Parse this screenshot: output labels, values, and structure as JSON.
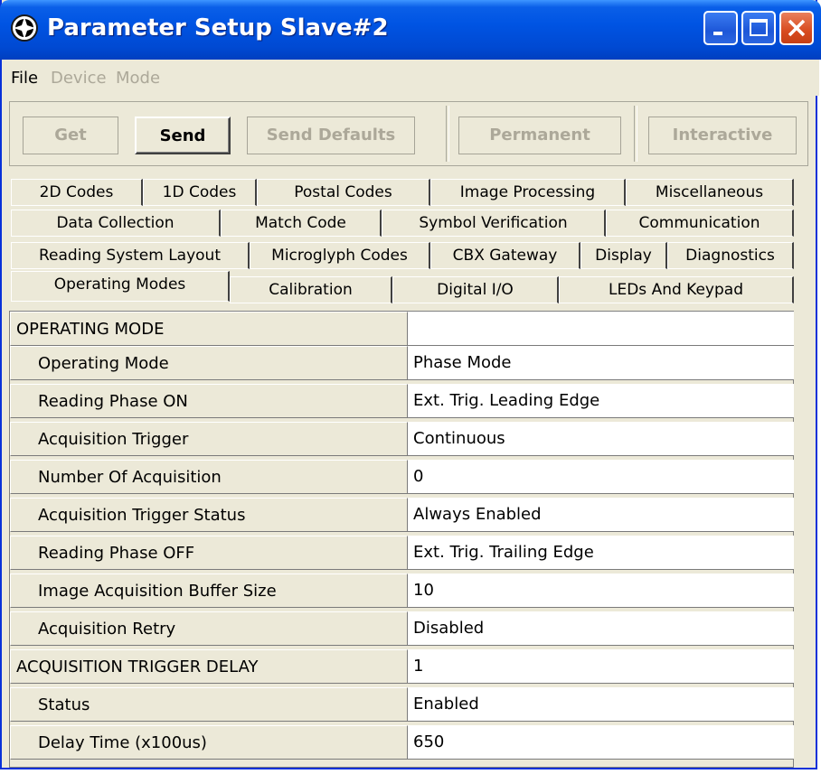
{
  "window": {
    "title": "Parameter Setup Slave#2",
    "colors": {
      "titlebar": "#0054e3",
      "close_button": "#d84b1f",
      "face": "#ece9d8"
    }
  },
  "menu": {
    "items": [
      {
        "label": "File",
        "enabled": true
      },
      {
        "label": "Device",
        "enabled": false
      },
      {
        "label": "Mode",
        "enabled": false
      }
    ]
  },
  "toolbar": {
    "get": "Get",
    "send": "Send",
    "send_defaults": "Send Defaults",
    "permanent": "Permanent",
    "interactive": "Interactive"
  },
  "tabs": {
    "row1": [
      "2D Codes",
      "1D Codes",
      "Postal Codes",
      "Image Processing",
      "Miscellaneous"
    ],
    "row2": [
      "Data Collection",
      "Match Code",
      "Symbol Verification",
      "Communication"
    ],
    "row3": [
      "Reading System Layout",
      "Microglyph Codes",
      "CBX Gateway",
      "Display",
      "Diagnostics"
    ],
    "row4": [
      "Operating Modes",
      "Calibration",
      "Digital I/O",
      "LEDs And Keypad"
    ],
    "active": "Operating Modes"
  },
  "grid": {
    "rows": [
      {
        "label": "OPERATING MODE",
        "value": ""
      },
      {
        "label": "Operating Mode",
        "value": "Phase Mode"
      },
      {
        "label": "Reading Phase ON",
        "value": "Ext. Trig. Leading Edge"
      },
      {
        "label": "Acquisition Trigger",
        "value": "Continuous"
      },
      {
        "label": "Number Of Acquisition",
        "value": "0"
      },
      {
        "label": "Acquisition Trigger Status",
        "value": "Always Enabled"
      },
      {
        "label": "Reading Phase OFF",
        "value": "Ext. Trig. Trailing Edge"
      },
      {
        "label": "Image Acquisition Buffer Size",
        "value": "10"
      },
      {
        "label": "Acquisition Retry",
        "value": "Disabled"
      },
      {
        "label": "ACQUISITION TRIGGER DELAY",
        "value": "1"
      },
      {
        "label": "Status",
        "value": "Enabled"
      },
      {
        "label": "Delay Time (x100us)",
        "value": "650"
      }
    ]
  }
}
